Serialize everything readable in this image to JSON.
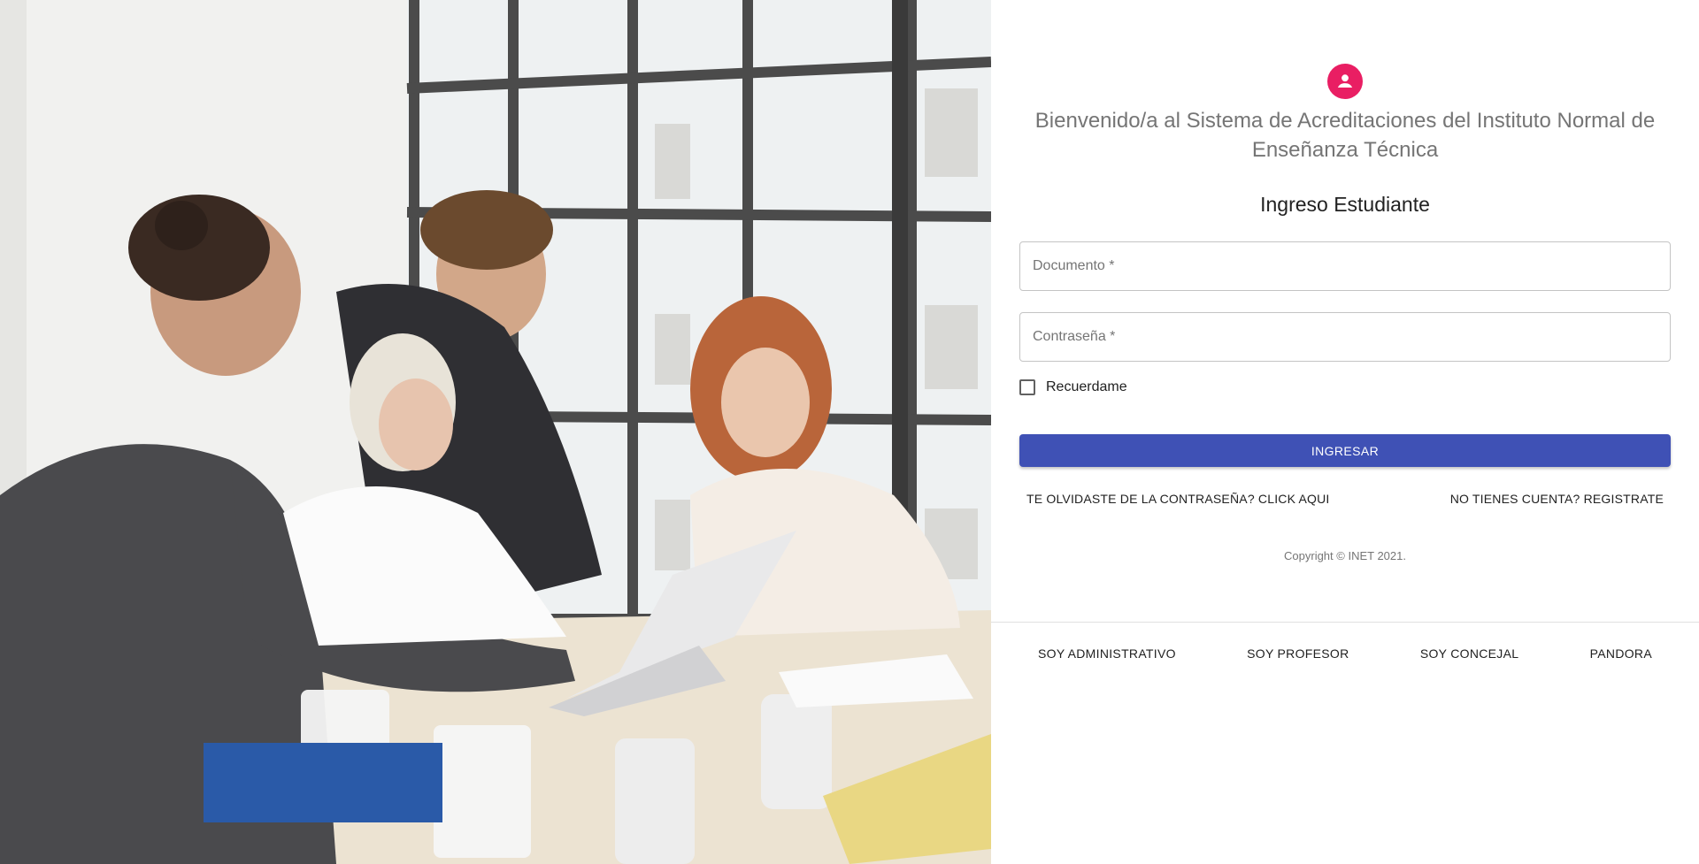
{
  "brand": {
    "avatar_icon": "account-circle-icon",
    "avatar_color": "#e91e63",
    "welcome": "Bienvenido/a al Sistema de Acreditaciones del Instituto Normal de Enseñanza Técnica"
  },
  "login": {
    "title": "Ingreso Estudiante",
    "document_placeholder": "Documento *",
    "password_placeholder": "Contraseña *",
    "remember_label": "Recuerdame",
    "remember_checked": false,
    "submit_label": "INGRESAR",
    "submit_color": "#3f51b5",
    "forgot_link": "TE OLVIDASTE DE LA CONTRASEÑA? CLICK AQUI",
    "register_link": "NO TIENES CUENTA? REGISTRATE"
  },
  "footer": {
    "copyright": "Copyright © INET 2021."
  },
  "roles": [
    {
      "label": "SOY ADMINISTRATIVO"
    },
    {
      "label": "SOY PROFESOR"
    },
    {
      "label": "SOY CONCEJAL"
    },
    {
      "label": "PANDORA"
    }
  ]
}
